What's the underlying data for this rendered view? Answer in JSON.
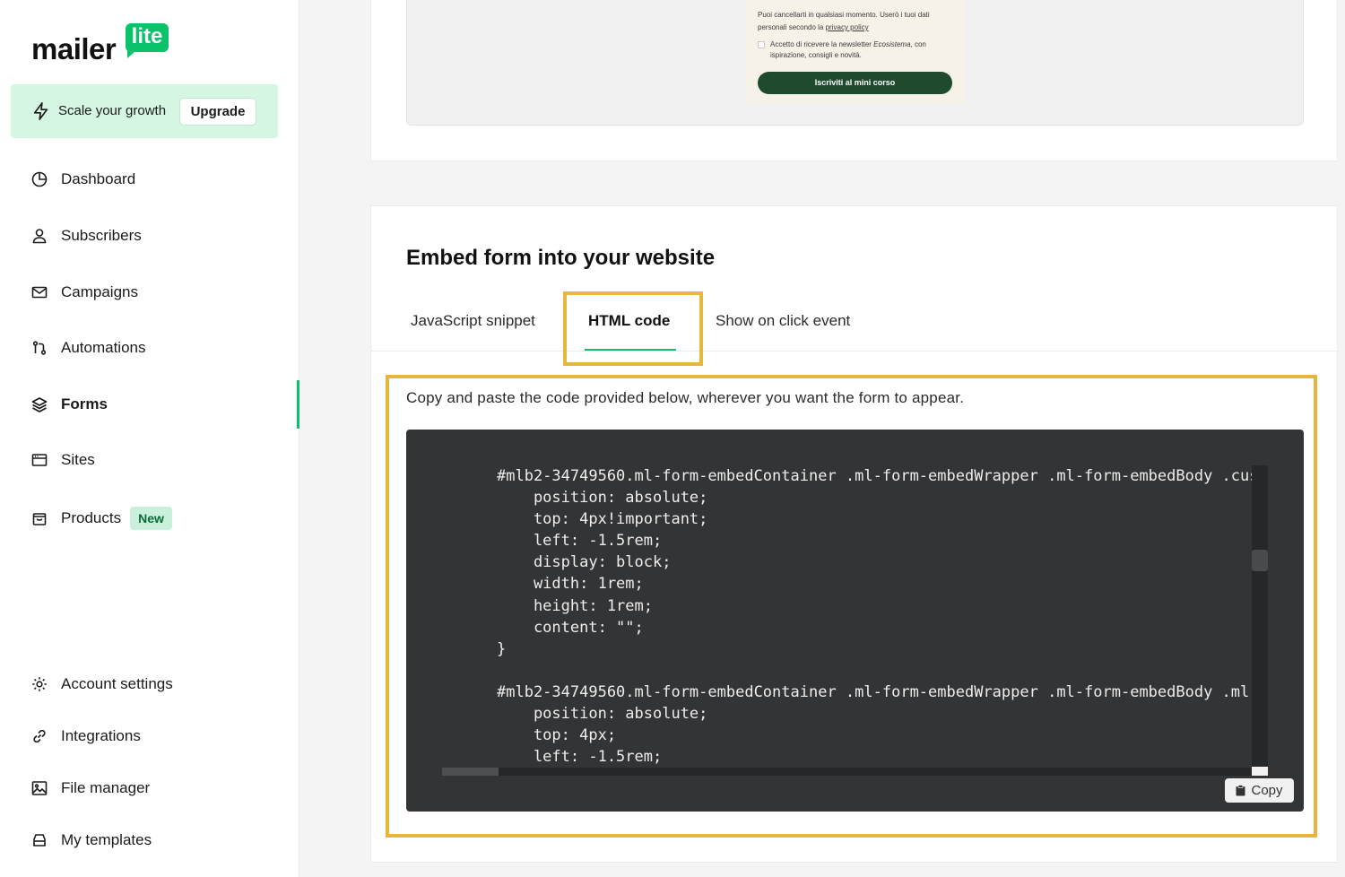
{
  "brand": {
    "logo_main": "mailer",
    "logo_badge": "lite",
    "accent": "#09c269"
  },
  "promo": {
    "text": "Scale your growth",
    "upgrade_label": "Upgrade"
  },
  "sidebar": {
    "items": [
      {
        "label": "Dashboard",
        "icon": "dashboard-icon"
      },
      {
        "label": "Subscribers",
        "icon": "user-icon"
      },
      {
        "label": "Campaigns",
        "icon": "mail-icon"
      },
      {
        "label": "Automations",
        "icon": "automation-icon"
      },
      {
        "label": "Forms",
        "icon": "layers-icon",
        "active": true
      },
      {
        "label": "Sites",
        "icon": "sites-icon"
      },
      {
        "label": "Products",
        "icon": "bag-icon",
        "badge": "New"
      }
    ],
    "bottom_items": [
      {
        "label": "Account settings",
        "icon": "gear-icon"
      },
      {
        "label": "Integrations",
        "icon": "link-icon"
      },
      {
        "label": "File manager",
        "icon": "image-icon"
      },
      {
        "label": "My templates",
        "icon": "template-icon"
      }
    ]
  },
  "form_preview": {
    "text_line1": "Puoi cancellarti in qualsiasi momento. Userò i tuoi dati",
    "text_line2_prefix": "personali secondo la ",
    "privacy_link": "privacy policy",
    "consent_prefix": "Accetto di ricevere la newsletter ",
    "consent_brand": "Ecosistema",
    "consent_suffix": ", con ispirazione, consigli e novità.",
    "button": "Iscriviti al mini corso"
  },
  "embed": {
    "title": "Embed form into your website",
    "tabs": [
      "JavaScript snippet",
      "HTML code",
      "Show on click event"
    ],
    "active_tab": "HTML code",
    "instructions": "Copy and paste the code provided below, wherever you want the form to appear.",
    "code_lines": [
      "#mlb2-34749560.ml-form-embedContainer .ml-form-embedWrapper .ml-form-embedBody .cus",
      "    position: absolute;",
      "    top: 4px!important;",
      "    left: -1.5rem;",
      "    display: block;",
      "    width: 1rem;",
      "    height: 1rem;",
      "    content: \"\";",
      "}",
      "",
      "#mlb2-34749560.ml-form-embedContainer .ml-form-embedWrapper .ml-form-embedBody .ml-",
      "    position: absolute;",
      "    top: 4px;",
      "    left: -1.5rem;"
    ],
    "copy_label": "Copy"
  }
}
